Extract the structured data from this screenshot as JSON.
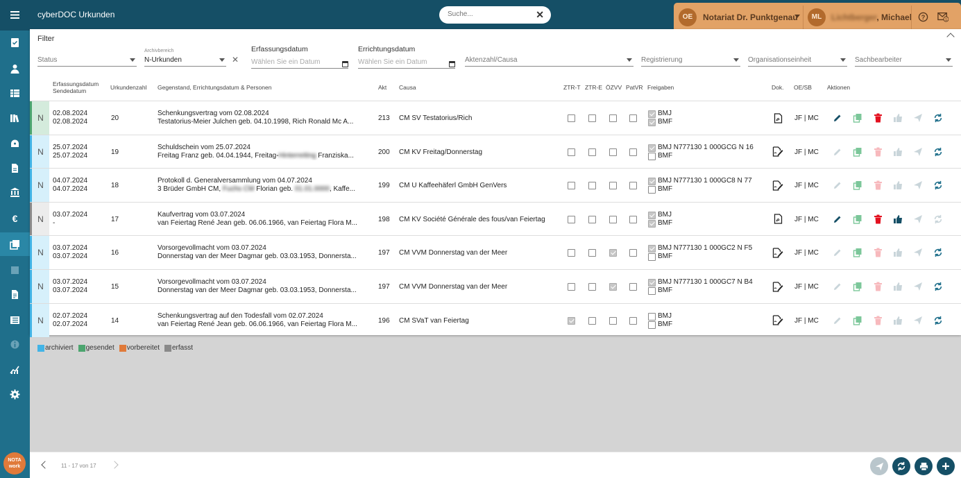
{
  "app": {
    "title": "cyberDOC Urkunden"
  },
  "search": {
    "placeholder": "Suche..."
  },
  "user": {
    "org_initials": "OE",
    "org_name": "Notariat Dr. Punktgenau",
    "user_initials": "ML",
    "user_name": "Lichtberger, Michael",
    "user_name_visible": ", Michael",
    "notification_count": "1"
  },
  "sidebar": {
    "icons": [
      "menu-icon",
      "task-icon",
      "person-icon",
      "table-icon",
      "library-icon",
      "vault-icon",
      "document-icon",
      "bank-icon",
      "euro-icon",
      "documents-icon",
      "square-icon",
      "file-icon",
      "list-icon",
      "info-icon",
      "analytics-icon",
      "gear-icon"
    ],
    "logo_text": "NOTA work"
  },
  "filter": {
    "title": "Filter",
    "status_label": "Status",
    "archiv_small": "Archivbereich",
    "archiv_value": "N-Urkunden",
    "erfassung_label": "Erfassungsdatum",
    "erfassung_placeholder": "Wählen Sie ein Datum",
    "errichtung_label": "Errichtungsdatum",
    "errichtung_placeholder": "Wählen Sie ein Datum",
    "akten_label": "Aktenzahl/Causa",
    "registrierung_label": "Registrierung",
    "org_label": "Organisationseinheit",
    "sb_label": "Sachbearbeiter"
  },
  "table": {
    "headers": {
      "erfassung": "Erfassungsdatum",
      "sende": "Sendedatum",
      "urkundenzahl": "Urkundenzahl",
      "gegenstand": "Gegenstand, Errichtungsdatum & Personen",
      "akt": "Akt",
      "causa": "Causa",
      "ztrt": "ZTR-T",
      "ztre": "ZTR-E",
      "ozvv": "ÖZVV",
      "patvr": "PatVR",
      "freigaben": "Freigaben",
      "dok": "Dok.",
      "oesb": "OE/SB",
      "aktionen": "Aktionen"
    },
    "rows": [
      {
        "n": "N",
        "status": "gesendet",
        "d1": "02.08.2024",
        "d2": "02.08.2024",
        "nr": "20",
        "g1": "Schenkungsvertrag vom 02.08.2024",
        "g2": "Testatorius-Meier Julchen geb. 04.10.1998, Rich Ronald Mc A...",
        "akt": "213",
        "causa": "CM SV Testatorius/Rich",
        "ztrt": false,
        "ztre": false,
        "ozvv": false,
        "patvr": false,
        "f1": "BMJ",
        "f1c": true,
        "f2": "BMF",
        "f2c": true,
        "doc": "pdf",
        "oesb": "JF | MC",
        "edit": true,
        "del": true,
        "up": false,
        "send": false,
        "sync": true
      },
      {
        "n": "N",
        "status": "archiviert",
        "d1": "25.07.2024",
        "d2": "25.07.2024",
        "nr": "19",
        "g1": "Schuldschein vom 25.07.2024",
        "g2": "Freitag Franz geb. 04.04.1944, Freitag-",
        "g2b": "Hinterreiting",
        "g2c": "Franziska...",
        "akt": "200",
        "causa": "CM KV Freitag/Donnerstag",
        "ztrt": false,
        "ztre": false,
        "ozvv": false,
        "patvr": false,
        "f1": "BMJ N777130 1 000GCG N 16",
        "f1c": true,
        "f2": "BMF",
        "f2c": false,
        "doc": "sign",
        "oesb": "JF | MC",
        "edit": false,
        "del": false,
        "up": false,
        "send": false,
        "sync": true
      },
      {
        "n": "N",
        "status": "archiviert",
        "d1": "04.07.2024",
        "d2": "04.07.2024",
        "nr": "18",
        "g1": "Protokoll d. Generalversammlung vom 04.07.2024",
        "g2": "3 Brüder GmbH CM,",
        "g2b": "Fuchs CM",
        "g2c": "Florian geb.",
        "g2d": "01.01.0000",
        "g2e": ", Kaffe...",
        "akt": "199",
        "causa": "CM U Kaffeehäferl GmbH GenVers",
        "ztrt": false,
        "ztre": false,
        "ozvv": false,
        "patvr": false,
        "f1": "BMJ N777130 1 000GC8 N 77",
        "f1c": true,
        "f2": "BMF",
        "f2c": false,
        "doc": "sign",
        "oesb": "JF | MC",
        "edit": false,
        "del": false,
        "up": false,
        "send": false,
        "sync": true
      },
      {
        "n": "N",
        "status": "erfasst",
        "d1": "03.07.2024",
        "d2": "-",
        "nr": "17",
        "g1": "Kaufvertrag vom 03.07.2024",
        "g2": "van Feiertag René Jean geb. 06.06.1966, van Feiertag Flora M...",
        "akt": "198",
        "causa": "CM KV Société Générale des fous/van Feiertag",
        "ztrt": false,
        "ztre": false,
        "ozvv": false,
        "patvr": false,
        "f1": "BMJ",
        "f1c": true,
        "f2": "BMF",
        "f2c": true,
        "doc": "pdf",
        "oesb": "JF | MC",
        "edit": true,
        "del": true,
        "up": true,
        "send": false,
        "sync": false
      },
      {
        "n": "N",
        "status": "archiviert",
        "d1": "03.07.2024",
        "d2": "03.07.2024",
        "nr": "16",
        "g1": "Vorsorgevollmacht vom 03.07.2024",
        "g2": "Donnerstag van der Meer Dagmar geb. 03.03.1953, Donnersta...",
        "akt": "197",
        "causa": "CM VVM Donnerstag van der Meer",
        "ztrt": false,
        "ztre": false,
        "ozvv": true,
        "patvr": false,
        "f1": "BMJ N777130 1 000GC2 N F5",
        "f1c": true,
        "f2": "BMF",
        "f2c": false,
        "doc": "sign",
        "oesb": "JF | MC",
        "edit": false,
        "del": false,
        "up": false,
        "send": false,
        "sync": true
      },
      {
        "n": "N",
        "status": "archiviert",
        "d1": "03.07.2024",
        "d2": "03.07.2024",
        "nr": "15",
        "g1": "Vorsorgevollmacht vom 03.07.2024",
        "g2": "Donnerstag van der Meer Dagmar geb. 03.03.1953, Donnersta...",
        "akt": "197",
        "causa": "CM VVM Donnerstag van der Meer",
        "ztrt": false,
        "ztre": false,
        "ozvv": true,
        "patvr": false,
        "f1": "BMJ N777130 1 000GC7 N B4",
        "f1c": true,
        "f2": "BMF",
        "f2c": false,
        "doc": "sign",
        "oesb": "JF | MC",
        "edit": false,
        "del": false,
        "up": false,
        "send": false,
        "sync": true
      },
      {
        "n": "N",
        "status": "archiviert",
        "d1": "02.07.2024",
        "d2": "02.07.2024",
        "nr": "14",
        "g1": "Schenkungsvertrag auf den Todesfall vom 02.07.2024",
        "g2": "van Feiertag René Jean geb. 06.06.1966, van Feiertag Flora M...",
        "akt": "196",
        "causa": "CM SVaT van Feiertag",
        "ztrt": true,
        "ztre": false,
        "ozvv": false,
        "patvr": false,
        "f1": "BMJ",
        "f1c": false,
        "f2": "BMF",
        "f2c": false,
        "doc": "sign",
        "oesb": "JF | MC",
        "edit": false,
        "del": false,
        "up": false,
        "send": false,
        "sync": true
      }
    ]
  },
  "legend": [
    {
      "label": "archiviert",
      "color": "#42b4e6"
    },
    {
      "label": "gesendet",
      "color": "#4ca56f"
    },
    {
      "label": "vorbereitet",
      "color": "#e07a3a"
    },
    {
      "label": "erfasst",
      "color": "#8a8a8a"
    }
  ],
  "status_colors": {
    "archiviert": "#42b4e6",
    "gesendet": "#4ca56f",
    "vorbereitet": "#e07a3a",
    "erfasst": "#8a8a8a"
  },
  "status_cell_colors": {
    "archiviert": "#d6f0fb",
    "gesendet": "#d4ebdc",
    "vorbereitet": "#f9e1d2",
    "erfasst": "#ececec"
  },
  "pagination": {
    "text": "11 - 17 von 17"
  }
}
